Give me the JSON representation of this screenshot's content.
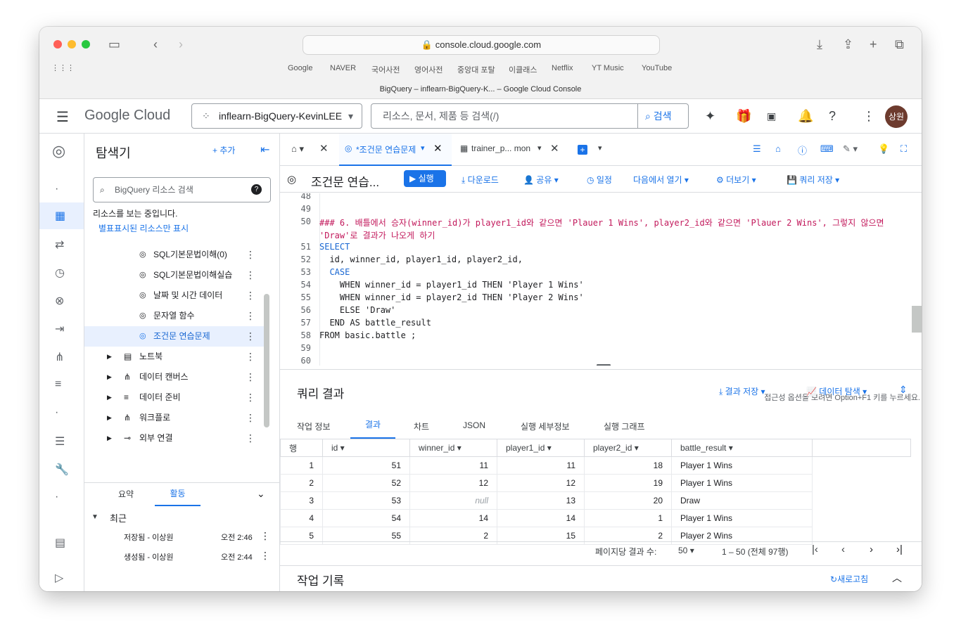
{
  "browser": {
    "url": "console.cloud.google.com",
    "favorites": [
      "Google",
      "NAVER",
      "국어사전",
      "영어사전",
      "중앙대 포탈",
      "이클래스",
      "Netflix",
      "YT Music",
      "YouTube"
    ],
    "tab_title": "BigQuery – inflearn-BigQuery-K... – Google Cloud Console"
  },
  "header": {
    "logo": "Google Cloud",
    "project": "inflearn-BigQuery-KevinLEE",
    "search_placeholder": "리소스, 문서, 제품 등 검색(/)",
    "search_button": "검색",
    "avatar": "상원"
  },
  "explorer": {
    "title": "탐색기",
    "add": "추가",
    "search_placeholder": "BigQuery 리소스 검색",
    "viewing": "리소스를 보는 중입니다.",
    "starred_only": "별표표시된 리소스만 표시",
    "queries": [
      "SQL기본문법이해(0)",
      "SQL기본문법이해실습",
      "날짜 및 시간 데이터",
      "문자열 함수",
      "조건문 연습문제"
    ],
    "groups": [
      "노트북",
      "데이터 캔버스",
      "데이터 준비",
      "워크플로",
      "외부 연결"
    ],
    "bottom_tabs": [
      "요약",
      "활동"
    ],
    "recent_label": "최근",
    "activity": [
      {
        "label": "저장됨 - 이상원",
        "time": "오전 2:46"
      },
      {
        "label": "생성됨 - 이상원",
        "time": "오전 2:44"
      }
    ]
  },
  "editor_tabs": [
    "*조건문 연습문제",
    "trainer_p... mon"
  ],
  "toolbar": {
    "title": "조건문 연습...",
    "run": "실행",
    "download": "다운로드",
    "share": "공유",
    "schedule": "일정",
    "open_in": "다음에서 열기",
    "more": "더보기",
    "save": "쿼리 저장"
  },
  "code_lines": [
    {
      "n": "48",
      "t": ""
    },
    {
      "n": "49",
      "t": ""
    },
    {
      "n": "50",
      "t": "### 6. 배틀에서 승자(winner_id)가 player1_id와 같으면 'Plauer 1 Wins', player2_id와 같으면 'Plauer 2 Wins', 그렇지 않으면"
    },
    {
      "n": "",
      "t": "'Draw'로 결과가 나오게 하기"
    },
    {
      "n": "51",
      "t": "SELECT"
    },
    {
      "n": "52",
      "t": "  id, winner_id, player1_id, player2_id,"
    },
    {
      "n": "53",
      "t": "  CASE"
    },
    {
      "n": "54",
      "t": "    WHEN winner_id = player1_id THEN 'Player 1 Wins'"
    },
    {
      "n": "55",
      "t": "    WHEN winner_id = player2_id THEN 'Player 2 Wins'"
    },
    {
      "n": "56",
      "t": "    ELSE 'Draw'"
    },
    {
      "n": "57",
      "t": "  END AS battle_result"
    },
    {
      "n": "58",
      "t": "FROM basic.battle ;"
    },
    {
      "n": "59",
      "t": ""
    },
    {
      "n": "60",
      "t": ""
    }
  ],
  "accessibility_hint": "접근성 옵션을 보려면 Option+F1 키를 누르세요.",
  "results": {
    "title": "쿼리 결과",
    "save": "결과 저장",
    "explore": "데이터 탐색",
    "tabs": [
      "작업 정보",
      "결과",
      "차트",
      "JSON",
      "실행 세부정보",
      "실행 그래프"
    ],
    "columns": [
      "행",
      "id",
      "winner_id",
      "player1_id",
      "player2_id",
      "battle_result"
    ],
    "rows": [
      [
        "1",
        "51",
        "11",
        "11",
        "18",
        "Player 1 Wins"
      ],
      [
        "2",
        "52",
        "12",
        "12",
        "19",
        "Player 1 Wins"
      ],
      [
        "3",
        "53",
        "null",
        "13",
        "20",
        "Draw"
      ],
      [
        "4",
        "54",
        "14",
        "14",
        "1",
        "Player 1 Wins"
      ],
      [
        "5",
        "55",
        "2",
        "15",
        "2",
        "Player 2 Wins"
      ]
    ],
    "per_page_label": "페이지당 결과 수:",
    "per_page": "50",
    "range": "1 – 50 (전체 97행)"
  },
  "history": {
    "title": "작업 기록",
    "refresh": "새로고침"
  }
}
